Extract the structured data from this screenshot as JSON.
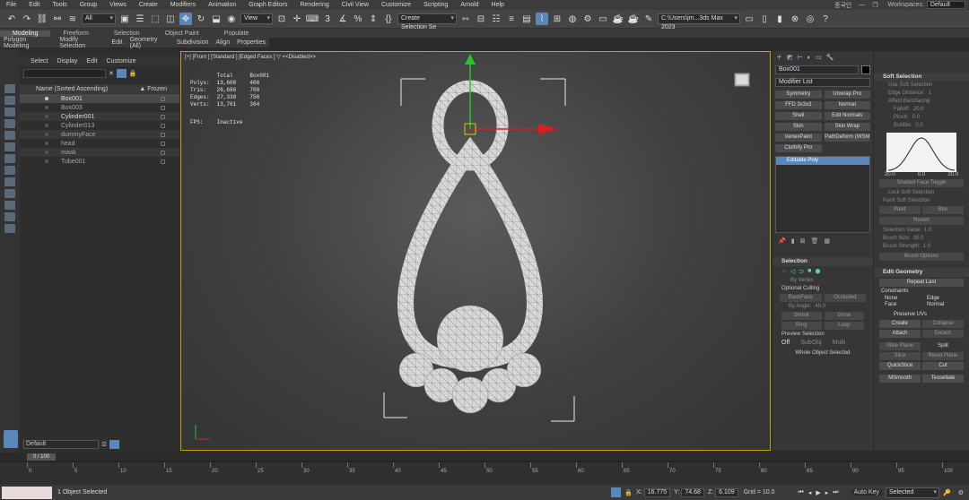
{
  "menu": [
    "File",
    "Edit",
    "Tools",
    "Group",
    "Views",
    "Create",
    "Modifiers",
    "Animation",
    "Graph Editors",
    "Rendering",
    "Civil View",
    "Customize",
    "Scripting",
    "Arnold",
    "Help"
  ],
  "workspace": {
    "lang": "중국인",
    "label": "Workspaces:",
    "value": "Default"
  },
  "toolbar": {
    "selection_filter": "All",
    "ref_coord": "View",
    "named_sel": "Create Selection Se",
    "path": "C:\\Users\\jm...3ds Max 2023"
  },
  "ribbon": {
    "tabs": [
      "Modeling",
      "Freeform",
      "Selection",
      "Object Paint",
      "Populate"
    ],
    "subtabs": [
      "Polygon Modeling",
      "Modify Selection",
      "Edit",
      "Geometry (All)",
      "Subdivision",
      "Align",
      "Properties"
    ]
  },
  "explorer": {
    "menu": [
      "Select",
      "Display",
      "Edit",
      "Customize"
    ],
    "col_name": "Name (Sorted Ascending)",
    "col_frozen": "▲ Frozen",
    "items": [
      "Box001",
      "Box003",
      "Cylinder001",
      "Cylinder013",
      "dummyFace",
      "head",
      "mask",
      "Tube001"
    ],
    "layer": "Default"
  },
  "viewport": {
    "label": "[+] [Front ] [Standard ] [Edged Faces ]  ▽  <<Disabled>>",
    "stats_head": [
      "",
      "Total",
      "Box001"
    ],
    "stats": [
      {
        "k": "Polys:",
        "t": "13,608",
        "o": "406"
      },
      {
        "k": "Tris:",
        "t": "26,686",
        "o": "700"
      },
      {
        "k": "Edges:",
        "t": "27,330",
        "o": "756"
      },
      {
        "k": "Verts:",
        "t": "13,761",
        "o": "364"
      }
    ],
    "fps_label": "FPS:",
    "fps_value": "Inactive"
  },
  "command_panel": {
    "object_name": "Box001",
    "modifier_list": "Modifier List",
    "modifiers": [
      "Symmetry",
      "Unwrap Pro",
      "FFD 3x3x3",
      "Normal",
      "Shell",
      "Edit Normals",
      "Skin",
      "Skin Wrap",
      "VertexPaint",
      "PathDeform (WSM",
      "Clothify Pro"
    ],
    "stack_item": "Editable Poly",
    "selection": {
      "title": "Selection",
      "by_vertex": "By Vertex",
      "optional_culling": "Optional Culling",
      "backface": "BackFace",
      "occluded": "Occluded",
      "by_angle": "By Angle:",
      "angle": "45.0",
      "shrink": "Shrink",
      "grow": "Grow",
      "ring": "Ring",
      "loop": "Loop",
      "preview": "Preview Selection",
      "off": "Off",
      "subobj": "SubObj",
      "multi": "Multi",
      "whole": "Whole Object Selected"
    }
  },
  "soft_selection": {
    "title": "Soft Selection",
    "use": "Use Soft Selection",
    "edge_distance": "Edge Distance:",
    "edge_value": "1",
    "affect_backfacing": "Affect Backfacing",
    "falloff": "Falloff:",
    "falloff_v": "20.0",
    "pinch": "Pinch:",
    "pinch_v": "0.0",
    "bubble": "Bubble:",
    "bubble_v": "0.0",
    "curve_ticks": [
      "20.0",
      "0.0",
      "20.0"
    ],
    "shaded": "Shaded Face Toggle",
    "lock": "Lock Soft Selection",
    "paint_title": "Paint Soft Selection",
    "paint": "Paint",
    "blur": "Blur",
    "revert": "Revert",
    "sel_value": "Selection Value:",
    "sel_value_v": "1.0",
    "brush_size": "Brush Size:",
    "brush_size_v": "20.0",
    "brush_strength": "Brush Strength:",
    "brush_strength_v": "1.0",
    "brush_options": "Brush Options"
  },
  "edit_geometry": {
    "title": "Edit Geometry",
    "repeat_last": "Repeat Last",
    "constraints": "Constraints",
    "none": "None",
    "edge": "Edge",
    "face": "Face",
    "normal": "Normal",
    "preserve_uvs": "Preserve UVs",
    "create": "Create",
    "collapse": "Collapse",
    "attach": "Attach",
    "detach": "Detach",
    "slice_plane": "Slice Plane",
    "split": "Split",
    "slice": "Slice",
    "reset_plane": "Reset Plane",
    "quickslice": "QuickSlice",
    "cut": "Cut",
    "msmooth": "MSmooth",
    "tessellate": "Tessellate"
  },
  "timeline": {
    "frame": "0 / 100",
    "ticks": [
      "0",
      "5",
      "10",
      "15",
      "20",
      "25",
      "30",
      "35",
      "40",
      "45",
      "50",
      "55",
      "60",
      "65",
      "70",
      "75",
      "80",
      "85",
      "90",
      "95",
      "100"
    ]
  },
  "status": {
    "selected": "1 Object Selected",
    "x_label": "X:",
    "x": "16.775",
    "y_label": "Y:",
    "y": "74.68",
    "z_label": "Z:",
    "z": "6.109",
    "grid": "Grid = 10.0",
    "autokey": "Auto Key",
    "set_sel": "Selected"
  }
}
